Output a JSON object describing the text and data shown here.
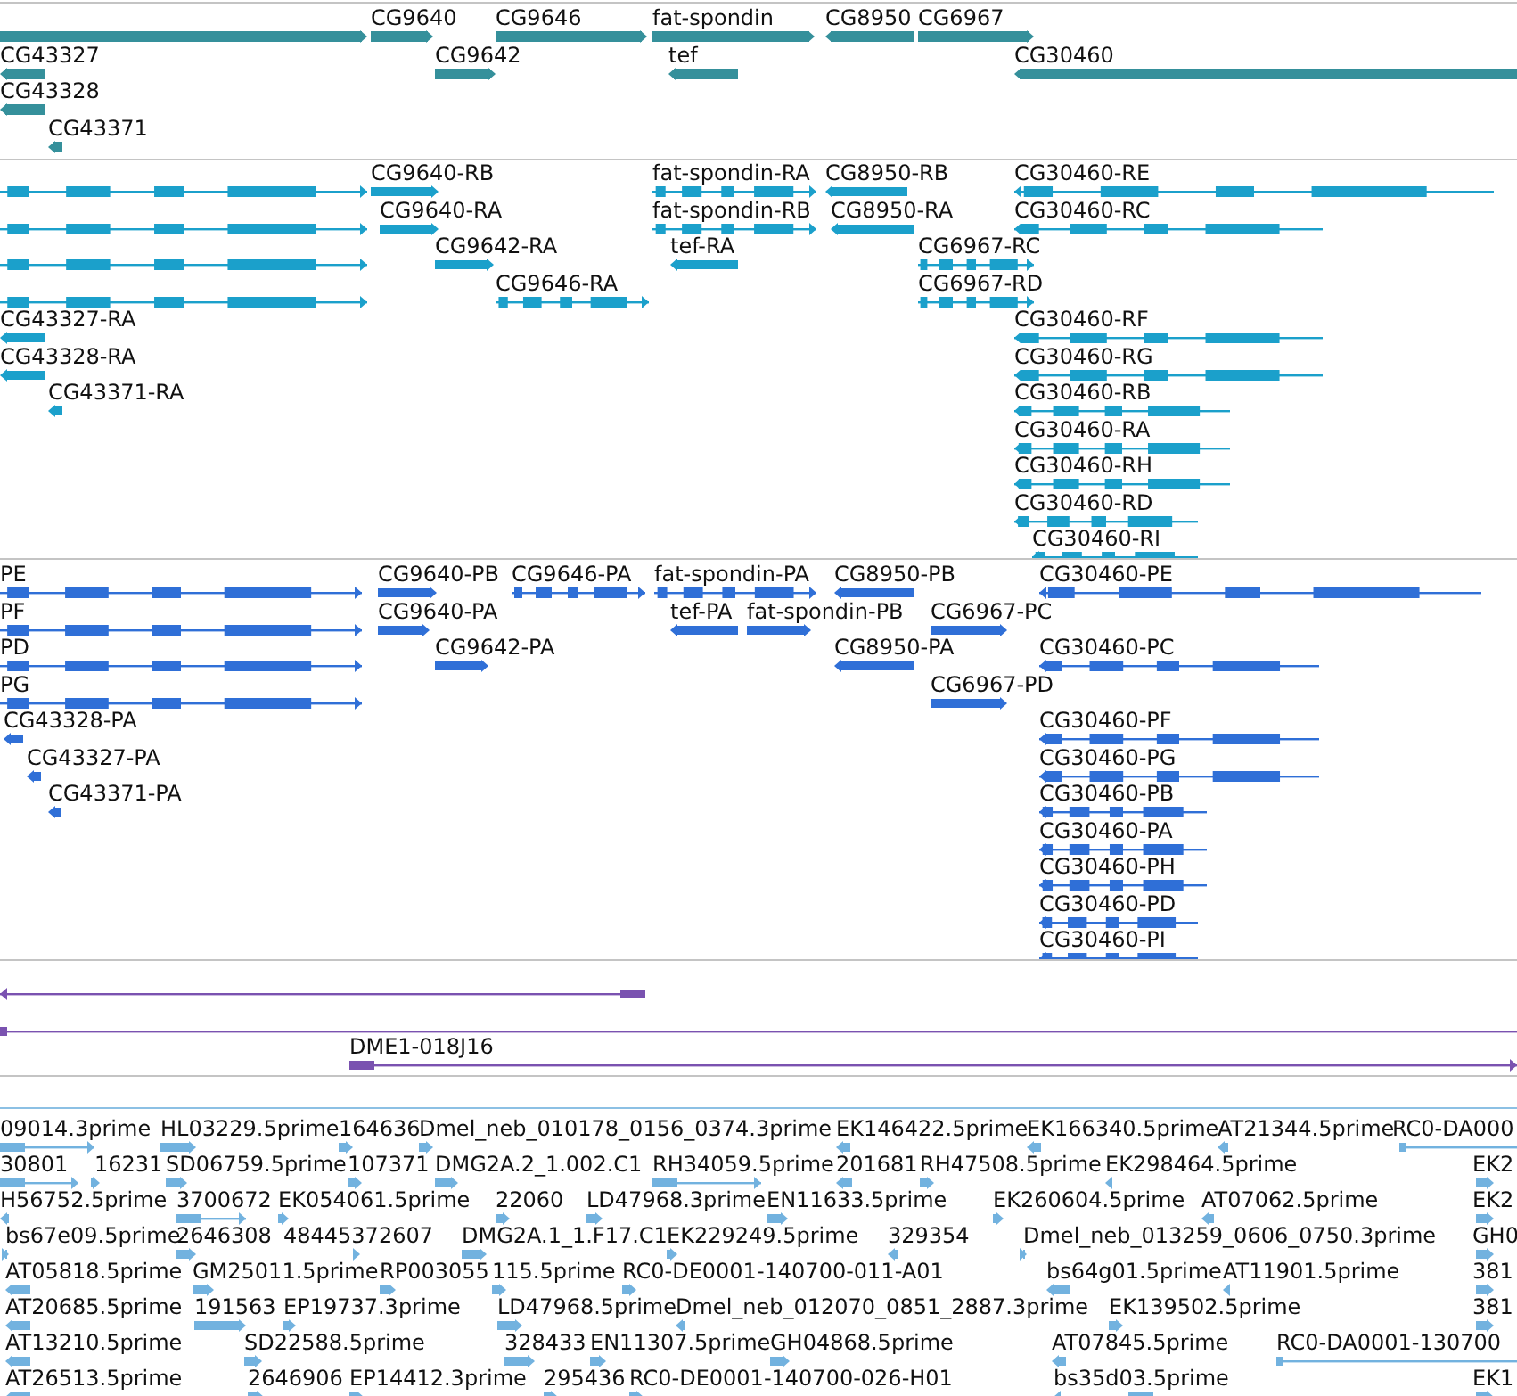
{
  "tracks": [
    {
      "kind": "gene",
      "features": [
        {
          "label": "CG9640"
        },
        {
          "label": "CG9646"
        },
        {
          "label": "fat-spondin"
        },
        {
          "label": "CG8950"
        },
        {
          "label": "CG6967"
        },
        {
          "label": "CG43327"
        },
        {
          "label": "CG9642"
        },
        {
          "label": "tef"
        },
        {
          "label": "CG30460"
        },
        {
          "label": "CG43328"
        },
        {
          "label": "CG43371"
        }
      ]
    },
    {
      "kind": "transcript",
      "features": [
        {
          "label": "CG9640-RB"
        },
        {
          "label": "fat-spondin-RA"
        },
        {
          "label": "CG8950-RB"
        },
        {
          "label": "CG30460-RE"
        },
        {
          "label": "CG9640-RA"
        },
        {
          "label": "fat-spondin-RB"
        },
        {
          "label": "CG8950-RA"
        },
        {
          "label": "CG30460-RC"
        },
        {
          "label": "CG9642-RA"
        },
        {
          "label": "tef-RA"
        },
        {
          "label": "CG6967-RC"
        },
        {
          "label": "CG9646-RA"
        },
        {
          "label": "CG6967-RD"
        },
        {
          "label": "CG43327-RA"
        },
        {
          "label": "CG30460-RF"
        },
        {
          "label": "CG43328-RA"
        },
        {
          "label": "CG30460-RG"
        },
        {
          "label": "CG43371-RA"
        },
        {
          "label": "CG30460-RB"
        },
        {
          "label": "CG30460-RA"
        },
        {
          "label": "CG30460-RH"
        },
        {
          "label": "CG30460-RD"
        },
        {
          "label": "CG30460-RI"
        }
      ]
    },
    {
      "kind": "cds",
      "features": [
        {
          "label": "PE"
        },
        {
          "label": "CG9640-PB"
        },
        {
          "label": "CG9646-PA"
        },
        {
          "label": "fat-spondin-PA"
        },
        {
          "label": "CG8950-PB"
        },
        {
          "label": "CG30460-PE"
        },
        {
          "label": "PF"
        },
        {
          "label": "CG9640-PA"
        },
        {
          "label": "tef-PA"
        },
        {
          "label": "fat-spondin-PB"
        },
        {
          "label": "CG6967-PC"
        },
        {
          "label": "PD"
        },
        {
          "label": "CG9642-PA"
        },
        {
          "label": "CG8950-PA"
        },
        {
          "label": "CG30460-PC"
        },
        {
          "label": "PG"
        },
        {
          "label": "CG6967-PD"
        },
        {
          "label": "CG43328-PA"
        },
        {
          "label": "CG30460-PF"
        },
        {
          "label": "CG43327-PA"
        },
        {
          "label": "CG30460-PG"
        },
        {
          "label": "CG43371-PA"
        },
        {
          "label": "CG30460-PB"
        },
        {
          "label": "CG30460-PA"
        },
        {
          "label": "CG30460-PH"
        },
        {
          "label": "CG30460-PD"
        },
        {
          "label": "CG30460-PI"
        }
      ]
    },
    {
      "kind": "clone",
      "features": [
        {
          "label": "DME1-018J16"
        }
      ]
    },
    {
      "kind": "est",
      "features": [
        {
          "label": "09014.3prime"
        },
        {
          "label": "HL03229.5prime"
        },
        {
          "label": "164636"
        },
        {
          "label": "Dmel_neb_010178_0156_0374.3prime"
        },
        {
          "label": "EK146422.5prime"
        },
        {
          "label": "EK166340.5prime"
        },
        {
          "label": "AT21344.5prime"
        },
        {
          "label": "RC0-DA000"
        },
        {
          "label": "30801"
        },
        {
          "label": "16231"
        },
        {
          "label": "SD06759.5prime"
        },
        {
          "label": "107371"
        },
        {
          "label": "DMG2A.2_1.002.C1"
        },
        {
          "label": "RH34059.5prime"
        },
        {
          "label": "201681"
        },
        {
          "label": "RH47508.5prime"
        },
        {
          "label": "EK298464.5prime"
        },
        {
          "label": "EK2"
        },
        {
          "label": "H56752.5prime"
        },
        {
          "label": "3700672"
        },
        {
          "label": "EK054061.5prime"
        },
        {
          "label": "22060"
        },
        {
          "label": "LD47968.3prime"
        },
        {
          "label": "EN11633.5prime"
        },
        {
          "label": "EK260604.5prime"
        },
        {
          "label": "AT07062.5prime"
        },
        {
          "label": "EK2"
        },
        {
          "label": "bs67e09.5prime"
        },
        {
          "label": "2646308"
        },
        {
          "label": "48445372607"
        },
        {
          "label": "DMG2A.1_1.F17.C1"
        },
        {
          "label": "EK229249.5prime"
        },
        {
          "label": "329354"
        },
        {
          "label": "Dmel_neb_013259_0606_0750.3prime"
        },
        {
          "label": "GH0"
        },
        {
          "label": "AT05818.5prime"
        },
        {
          "label": "GM25011.5prime"
        },
        {
          "label": "RP003055"
        },
        {
          "label": "115.5prime"
        },
        {
          "label": "RC0-DE0001-140700-011-A01"
        },
        {
          "label": "bs64g01.5prime"
        },
        {
          "label": "AT11901.5prime"
        },
        {
          "label": "381"
        },
        {
          "label": "AT20685.5prime"
        },
        {
          "label": "191563"
        },
        {
          "label": "EP19737.3prime"
        },
        {
          "label": "LD47968.5prime"
        },
        {
          "label": "Dmel_neb_012070_0851_2887.3prime"
        },
        {
          "label": "EK139502.5prime"
        },
        {
          "label": "381"
        },
        {
          "label": "AT13210.5prime"
        },
        {
          "label": "SD22588.5prime"
        },
        {
          "label": "328433"
        },
        {
          "label": "EN11307.5prime"
        },
        {
          "label": "GH04868.5prime"
        },
        {
          "label": "AT07845.5prime"
        },
        {
          "label": "RC0-DA0001-130700"
        },
        {
          "label": "AT26513.5prime"
        },
        {
          "label": "2646906"
        },
        {
          "label": "EP14412.3prime"
        },
        {
          "label": "295436"
        },
        {
          "label": "RC0-DE0001-140700-026-H01"
        },
        {
          "label": "bs35d03.5prime"
        },
        {
          "label": "EK1"
        }
      ]
    }
  ]
}
